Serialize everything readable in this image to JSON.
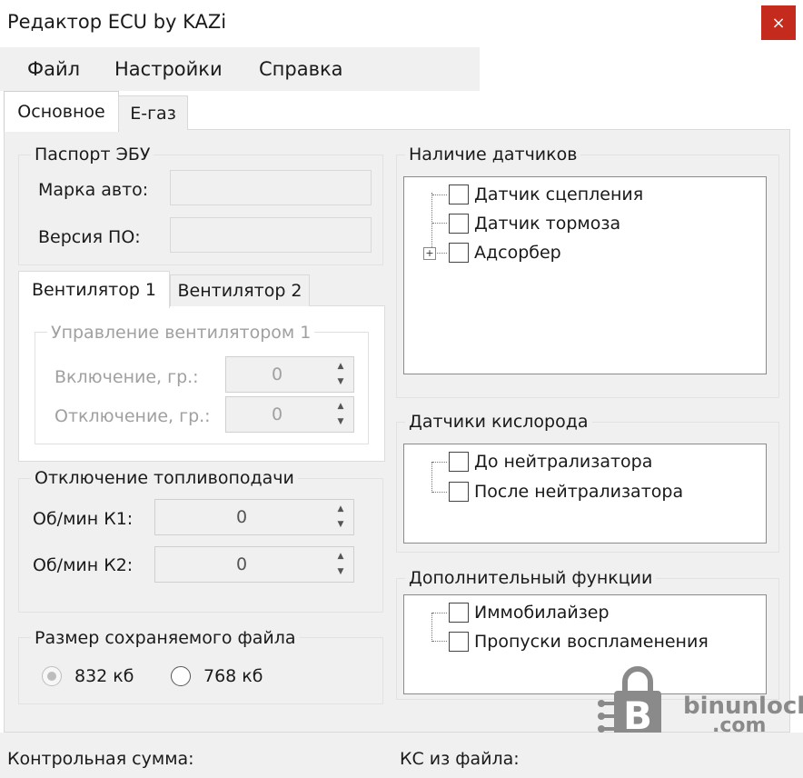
{
  "window": {
    "title": "Редактор ECU by  KAZi",
    "close_glyph": "×"
  },
  "menu": [
    "Файл",
    "Настройки",
    "Справка"
  ],
  "tabs": [
    "Основное",
    "E-газ"
  ],
  "passport": {
    "title": "Паспорт ЭБУ",
    "car_label": "Марка авто:",
    "car_value": "",
    "version_label": "Версия ПО:",
    "version_value": ""
  },
  "fan_tabs": [
    "Вентилятор 1",
    "Вентилятор 2"
  ],
  "fan": {
    "group_title": "Управление вентилятором 1",
    "on_label": "Включение, гр.:",
    "on_value": "0",
    "off_label": "Отключение, гр.:",
    "off_value": "0"
  },
  "fuel_cut": {
    "title": "Отключение топливоподачи",
    "k1_label": "Об/мин К1:",
    "k1_value": "0",
    "k2_label": "Об/мин К2:",
    "k2_value": "0"
  },
  "file_size": {
    "title": "Размер сохраняемого файла",
    "options": [
      "832 кб",
      "768 кб"
    ],
    "selected": "832 кб"
  },
  "sensors": {
    "title": "Наличие датчиков",
    "items": [
      "Датчик сцепления",
      "Датчик тормоза",
      "Адсорбер"
    ]
  },
  "oxygen": {
    "title": "Датчики кислорода",
    "items": [
      "До нейтрализатора",
      "После нейтрализатора"
    ]
  },
  "extra": {
    "title": "Дополнительный функции",
    "items": [
      "Иммобилайзер",
      "Пропуски воспламенения"
    ]
  },
  "status": {
    "checksum_label": "Контрольная сумма:",
    "file_checksum_label": "КС из файла:"
  },
  "watermark": {
    "text": "binunlock",
    "subtext": ".com"
  },
  "colors": {
    "close_button": "#c42b1c",
    "panel": "#f0f0f0",
    "watermark": "#8a8a8a"
  }
}
